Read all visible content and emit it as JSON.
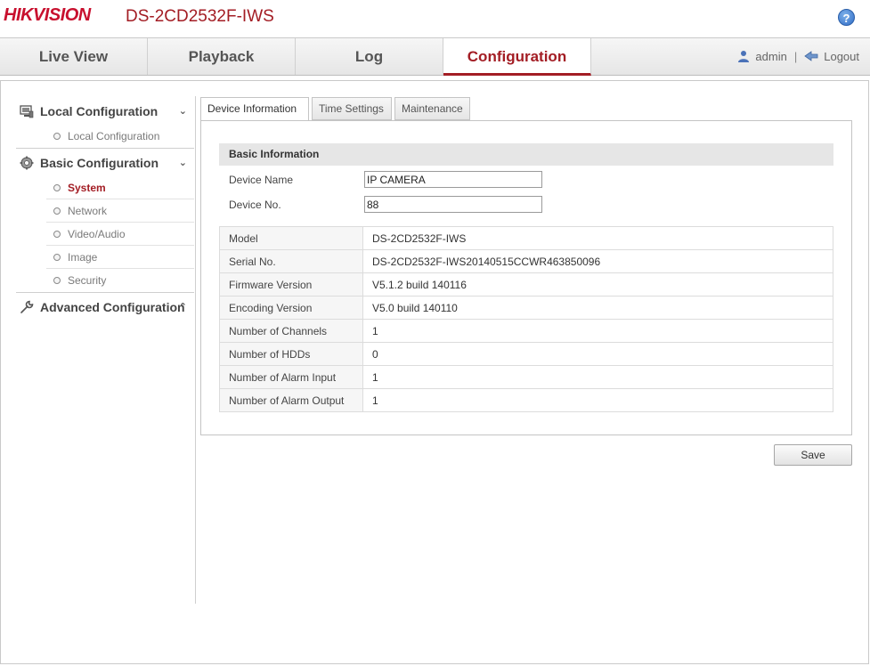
{
  "header": {
    "logo_part1": "HIK",
    "logo_part2": "VISION",
    "model": "DS-2CD2532F-IWS",
    "help_label": "?"
  },
  "nav": {
    "tabs": [
      {
        "label": "Live View"
      },
      {
        "label": "Playback"
      },
      {
        "label": "Log"
      },
      {
        "label": "Configuration"
      }
    ],
    "active_tab": "Configuration",
    "user": "admin",
    "separator": "|",
    "logout": "Logout"
  },
  "sidebar": {
    "sections": [
      {
        "label": "Local Configuration",
        "icon": "computer-icon",
        "chevron": "⌄",
        "items": [
          {
            "label": "Local Configuration"
          }
        ]
      },
      {
        "label": "Basic Configuration",
        "icon": "gear-icon",
        "chevron": "⌄",
        "items": [
          {
            "label": "System"
          },
          {
            "label": "Network"
          },
          {
            "label": "Video/Audio"
          },
          {
            "label": "Image"
          },
          {
            "label": "Security"
          }
        ]
      },
      {
        "label": "Advanced Configuration",
        "icon": "wrench-icon",
        "chevron": "⌃",
        "items": []
      }
    ],
    "active_item": "System"
  },
  "content": {
    "tabs": [
      {
        "label": "Device Information"
      },
      {
        "label": "Time Settings"
      },
      {
        "label": "Maintenance"
      }
    ],
    "active_tab": "Device Information",
    "section_title": "Basic Information",
    "fields": {
      "device_name": {
        "label": "Device Name",
        "value": "IP CAMERA"
      },
      "device_no": {
        "label": "Device No.",
        "value": "88"
      }
    },
    "info_rows": [
      {
        "label": "Model",
        "value": "DS-2CD2532F-IWS"
      },
      {
        "label": "Serial No.",
        "value": "DS-2CD2532F-IWS20140515CCWR463850096"
      },
      {
        "label": "Firmware Version",
        "value": "V5.1.2 build 140116"
      },
      {
        "label": "Encoding Version",
        "value": "V5.0 build 140110"
      },
      {
        "label": "Number of Channels",
        "value": "1"
      },
      {
        "label": "Number of HDDs",
        "value": "0"
      },
      {
        "label": "Number of Alarm Input",
        "value": "1"
      },
      {
        "label": "Number of Alarm Output",
        "value": "1"
      }
    ],
    "save_label": "Save"
  },
  "colors": {
    "brand": "#c8102e",
    "accent": "#a31d24"
  }
}
